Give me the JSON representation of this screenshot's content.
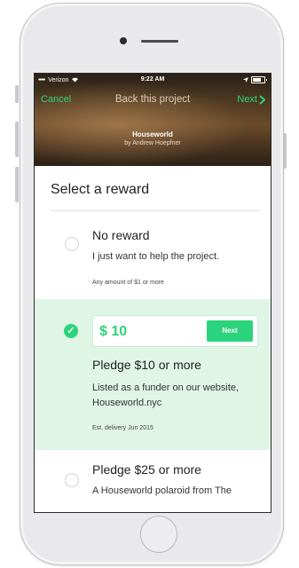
{
  "status_bar": {
    "carrier_dots": "•••••",
    "carrier": "Verizon",
    "wifi_icon": "wifi-icon",
    "time": "9:22 AM",
    "location_icon": "location-arrow-icon",
    "battery_icon": "battery-icon"
  },
  "nav": {
    "cancel_label": "Cancel",
    "title": "Back this project",
    "next_label": "Next",
    "next_icon": "chevron-right-icon"
  },
  "project": {
    "name": "Houseworld",
    "author": "by Andrew Hoepfner"
  },
  "section_title": "Select a reward",
  "rewards": [
    {
      "name": "No reward",
      "description": "I just want to help the project.",
      "meta": "Any amount of $1 or more",
      "selected": false
    },
    {
      "amount": "$ 10",
      "amount_button": "Next",
      "name": "Pledge $10 or more",
      "description": "Listed as a funder on our website, Houseworld.nyc",
      "meta": "Est. delivery Jun 2015",
      "selected": true
    },
    {
      "name": "Pledge $25 or more",
      "description": "A Houseworld polaroid from The",
      "selected": false
    }
  ],
  "colors": {
    "accent": "#2bd37c",
    "selected_background": "#dff6e7"
  }
}
